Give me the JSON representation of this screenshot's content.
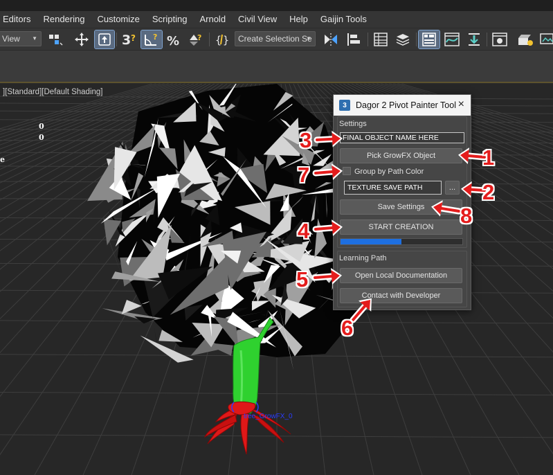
{
  "menubar": {
    "items": [
      "Editors",
      "Rendering",
      "Customize",
      "Scripting",
      "Arnold",
      "Civil View",
      "Help",
      "Gaijin Tools"
    ]
  },
  "toolbar": {
    "view_dropdown": "View",
    "selection_set_dropdown": "Create Selection Se",
    "icons": [
      "select-link-icon",
      "move-icon",
      "select-object-icon",
      "snap-3d-icon",
      "angle-snap-icon",
      "percent-snap-icon",
      "spinner-snap-icon",
      "named-selection-icon",
      "mirror-icon",
      "align-icon",
      "scene-explorer-icon",
      "layer-explorer-icon",
      "toggle-ribbon-icon",
      "curve-editor-icon",
      "schematic-view-icon",
      "material-editor-icon",
      "render-setup-icon",
      "render-icon"
    ]
  },
  "viewport": {
    "label": "][Standard][Default Shading]",
    "values": [
      "0",
      "0"
    ],
    "edge_char": "e",
    "object_name": "tree_GrowFX_0"
  },
  "tool_window": {
    "title": "Dagor 2 Pivot Painter Tool",
    "icon_text": "3",
    "close": "×",
    "settings_label": "Settings",
    "object_name_field": "FINAL OBJECT NAME HERE",
    "pick_button": "Pick GrowFX Object",
    "group_checkbox_label": "Group by Path Color",
    "group_checked": false,
    "texture_path_field": "TEXTURE SAVE PATH",
    "browse_button": "...",
    "save_settings_button": "Save Settings",
    "start_button": "START CREATION",
    "progress": 0.5,
    "learning_label": "Learning Path",
    "docs_button": "Open Local Documentation",
    "contact_button": "Contact with Developer"
  },
  "annotations": [
    "1",
    "2",
    "3",
    "4",
    "5",
    "6",
    "7",
    "8"
  ],
  "colors": {
    "annotation": "#e41c1c",
    "progress": "#1e6fe0",
    "trunk": "#2fd12f",
    "roots": "#e01818"
  }
}
